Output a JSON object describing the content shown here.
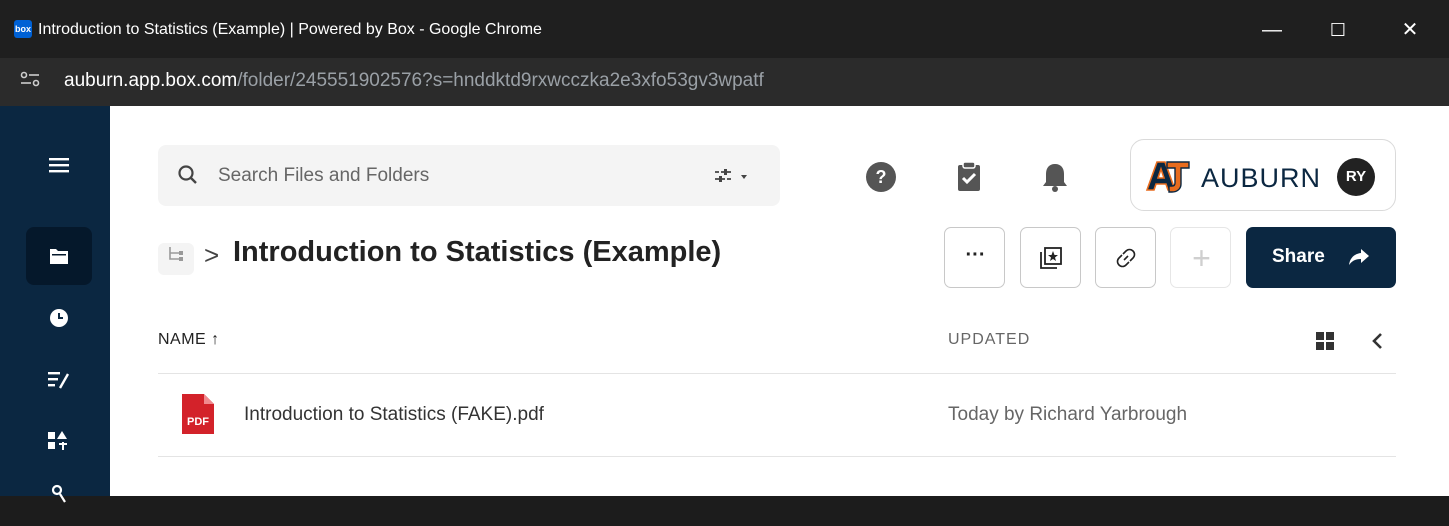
{
  "window": {
    "title": "Introduction to Statistics (Example) | Powered by Box - Google Chrome",
    "favicon_text": "box",
    "controls": {
      "minimize": "—",
      "maximize": "☐",
      "close": "✕"
    }
  },
  "address": {
    "host": "auburn.app.box.com",
    "path": "/folder/245551902576?s=hnddktd9rxwcczka2e3xfo53gv3wpatf"
  },
  "sidebar": {
    "items": [
      {
        "name": "menu",
        "glyph": "≡"
      },
      {
        "name": "all-files",
        "glyph": "▬",
        "active": true
      },
      {
        "name": "recents",
        "glyph": "◷"
      },
      {
        "name": "notes",
        "glyph": "≡/"
      },
      {
        "name": "apps",
        "glyph": "▪▲"
      },
      {
        "name": "users",
        "glyph": "ϙ"
      }
    ]
  },
  "search": {
    "placeholder": "Search Files and Folders"
  },
  "brand": {
    "name": "AUBURN",
    "avatar": "RY"
  },
  "breadcrumb": {
    "separator": ">",
    "folder_title": "Introduction to Statistics (Example)"
  },
  "actions": {
    "more_label": "···",
    "add_label": "+",
    "share_label": "Share"
  },
  "table": {
    "col_name": "NAME ↑",
    "col_updated": "UPDATED",
    "rows": [
      {
        "name": "Introduction to Statistics (FAKE).pdf",
        "updated": "Today by Richard Yarbrough",
        "badge": "PDF"
      }
    ]
  },
  "colors": {
    "sidebar_bg": "#0b2741",
    "share_bg": "#0b2741",
    "pdf_red": "#d3222a",
    "auburn_orange": "#e86c1e",
    "auburn_navy": "#0b2741"
  }
}
